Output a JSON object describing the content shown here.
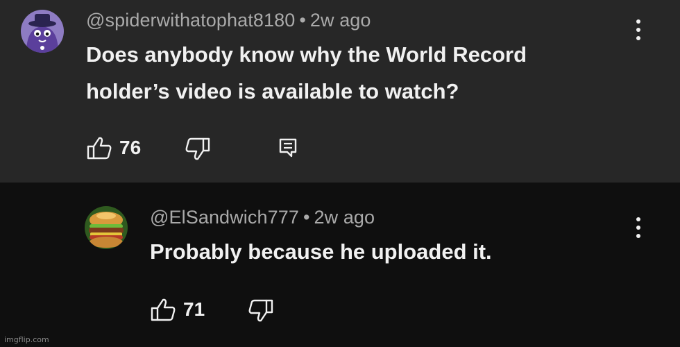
{
  "comment": {
    "author": "@spiderwithatophat8180",
    "separator": "•",
    "time": "2w ago",
    "text_lines": [
      "Does anybody know why the World Record",
      "holder’s video is available to watch?"
    ],
    "like_count": "76",
    "icons": {
      "avatar": "purple-cartoon-avatar",
      "like": "thumbs-up-icon",
      "dislike": "thumbs-down-icon",
      "reply": "reply-comment-icon",
      "menu": "more-vert-icon"
    }
  },
  "reply": {
    "author": "@ElSandwich777",
    "separator": "•",
    "time": "2w ago",
    "text_lines": [
      "Probably because he uploaded it."
    ],
    "like_count": "71",
    "icons": {
      "avatar": "sandwich-avatar",
      "like": "thumbs-up-icon",
      "dislike": "thumbs-down-icon",
      "menu": "more-vert-icon"
    }
  },
  "watermark": "imgflip.com",
  "colors": {
    "top_background": "#272727",
    "bottom_background": "#0f0f0f",
    "text": "#f1f1f1",
    "meta_text": "#aaaaaa"
  }
}
